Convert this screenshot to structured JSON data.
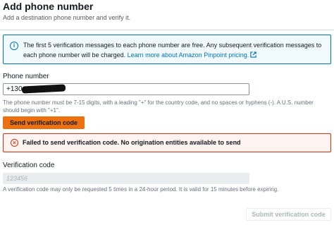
{
  "header": {
    "title": "Add phone number",
    "subtitle": "Add a destination phone number and verify it."
  },
  "info": {
    "message": "The first 5 verification messages to each phone number are free. Any subsequent verification messages to each phone number will be charged.",
    "link_text": "Learn more about Amazon Pinpoint pricing.",
    "icon": "info-icon",
    "color": "#0073bb"
  },
  "phone": {
    "label": "Phone number",
    "value": "+130",
    "hint": "The phone number must be 7-15 digits, with a leading \"+\" for the country code, and no spaces or hyphens (-). A U.S. number should begin with \"+1\"."
  },
  "send_button": {
    "label": "Send verification code",
    "color": "#ec7211"
  },
  "error": {
    "message": "Failed to send verification code. No origination entities available to send",
    "icon": "error-icon",
    "color": "#d13212"
  },
  "code": {
    "label": "Verification code",
    "placeholder": "123456",
    "hint": "A verification code may only be requested 5 times in a 24-hour period. It is valid for 15 minutes before expiring."
  },
  "submit_button": {
    "label": "Submit verification code"
  }
}
